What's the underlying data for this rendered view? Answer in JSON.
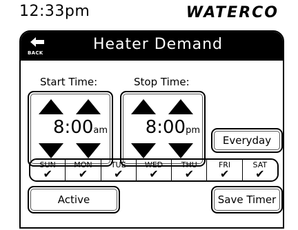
{
  "status": {
    "time": "12:33pm",
    "brand": "WATERCO"
  },
  "header": {
    "back_label": "BACK",
    "title": "Heater Demand"
  },
  "start": {
    "label": "Start Time:",
    "time": "8:00",
    "ampm": "am"
  },
  "stop": {
    "label": "Stop Time:",
    "time": "8:00",
    "ampm": "pm"
  },
  "buttons": {
    "everyday": "Everyday",
    "active": "Active",
    "save": "Save Timer"
  },
  "days": [
    {
      "name": "SUN",
      "check": "✔"
    },
    {
      "name": "MON",
      "check": "✔"
    },
    {
      "name": "TUE",
      "check": "✔"
    },
    {
      "name": "WED",
      "check": "✔"
    },
    {
      "name": "THU",
      "check": "✔"
    },
    {
      "name": "FRI",
      "check": "✔"
    },
    {
      "name": "SAT",
      "check": "✔"
    }
  ],
  "colors": {
    "foreground": "#000000",
    "background": "#ffffff"
  }
}
